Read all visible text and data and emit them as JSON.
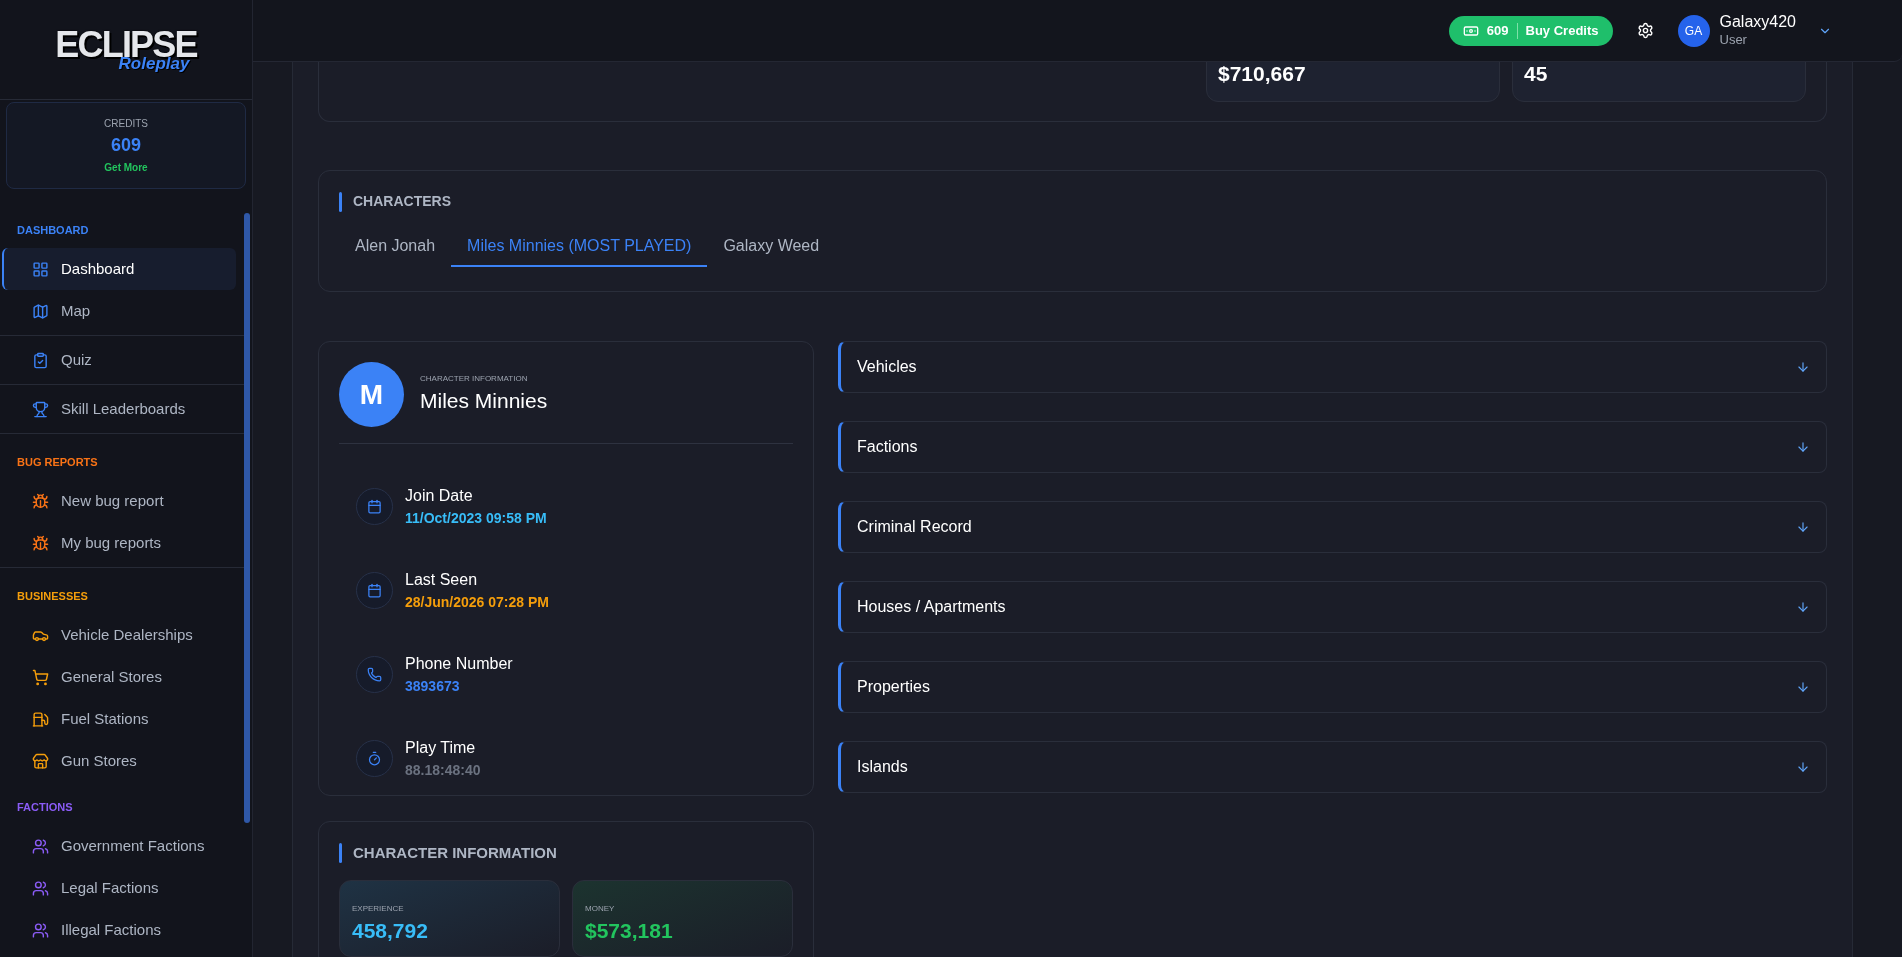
{
  "sidebar": {
    "logo": {
      "title": "ECLIPSE",
      "subtitle": "Roleplay"
    },
    "credits": {
      "label": "CREDITS",
      "value": "609",
      "link": "Get More"
    },
    "sections": [
      {
        "title": "DASHBOARD",
        "color": "#3b82f6",
        "divided": true,
        "groups": [
          [
            {
              "label": "Dashboard",
              "kind": "grid",
              "selected": true
            },
            {
              "label": "Map",
              "kind": "map",
              "selected": false
            }
          ],
          [
            {
              "label": "Quiz",
              "kind": "clipboard",
              "selected": false
            }
          ],
          [
            {
              "label": "Skill Leaderboards",
              "kind": "trophy",
              "selected": false
            }
          ]
        ]
      },
      {
        "title": "BUG REPORTS",
        "color": "#f97316",
        "divided": true,
        "groups": [
          [
            {
              "label": "New bug report",
              "kind": "bug",
              "selected": false
            },
            {
              "label": "My bug reports",
              "kind": "bug",
              "selected": false
            }
          ]
        ]
      },
      {
        "title": "BUSINESSES",
        "color": "#f59e0b",
        "divided": false,
        "groups": [
          [
            {
              "label": "Vehicle Dealerships",
              "kind": "car",
              "selected": false
            },
            {
              "label": "General Stores",
              "kind": "cart",
              "selected": false
            },
            {
              "label": "Fuel Stations",
              "kind": "fuel",
              "selected": false
            },
            {
              "label": "Gun Stores",
              "kind": "store",
              "selected": false
            }
          ]
        ]
      },
      {
        "title": "FACTIONS",
        "color": "#8b5cf6",
        "divided": false,
        "groups": [
          [
            {
              "label": "Government Factions",
              "kind": "users",
              "selected": false
            },
            {
              "label": "Legal Factions",
              "kind": "users",
              "selected": false
            },
            {
              "label": "Illegal Factions",
              "kind": "users",
              "selected": false
            }
          ]
        ]
      }
    ]
  },
  "header": {
    "credits_button": {
      "value": "609",
      "label": "Buy Credits"
    },
    "user": {
      "initials": "GA",
      "name": "Galaxy420",
      "role": "User"
    }
  },
  "summary_stats": [
    "$710,667",
    "45"
  ],
  "characters": {
    "title": "CHARACTERS",
    "tabs": [
      {
        "label": "Alen Jonah",
        "selected": false
      },
      {
        "label": "Miles Minnies (MOST PLAYED)",
        "selected": true
      },
      {
        "label": "Galaxy Weed",
        "selected": false
      }
    ]
  },
  "character_card": {
    "initial": "M",
    "caption": "CHARACTER INFORMATION",
    "name": "Miles Minnies",
    "details": [
      {
        "label": "Join Date",
        "value": "11/Oct/2023 09:58 PM",
        "color": "#38bdf8",
        "kind": "calendar"
      },
      {
        "label": "Last Seen",
        "value": "28/Jun/2026 07:28 PM",
        "color": "#f59e0b",
        "kind": "calendar"
      },
      {
        "label": "Phone Number",
        "value": "3893673",
        "color": "#3b82f6",
        "kind": "phone"
      },
      {
        "label": "Play Time",
        "value": "88.18:48:40",
        "color": "#6b7280",
        "kind": "timer"
      }
    ]
  },
  "character_info": {
    "title": "CHARACTER INFORMATION",
    "stats": [
      {
        "label": "EXPERIENCE",
        "value": "458,792",
        "color": "#38bdf8"
      },
      {
        "label": "MONEY",
        "value": "$573,181",
        "color": "#22c55e"
      }
    ]
  },
  "sections": [
    {
      "title": "Vehicles",
      "expanded": false
    },
    {
      "title": "Factions",
      "expanded": false
    },
    {
      "title": "Criminal Record",
      "expanded": false
    },
    {
      "title": "Houses / Apartments",
      "expanded": false
    },
    {
      "title": "Properties",
      "expanded": false
    },
    {
      "title": "Islands",
      "expanded": false
    }
  ]
}
